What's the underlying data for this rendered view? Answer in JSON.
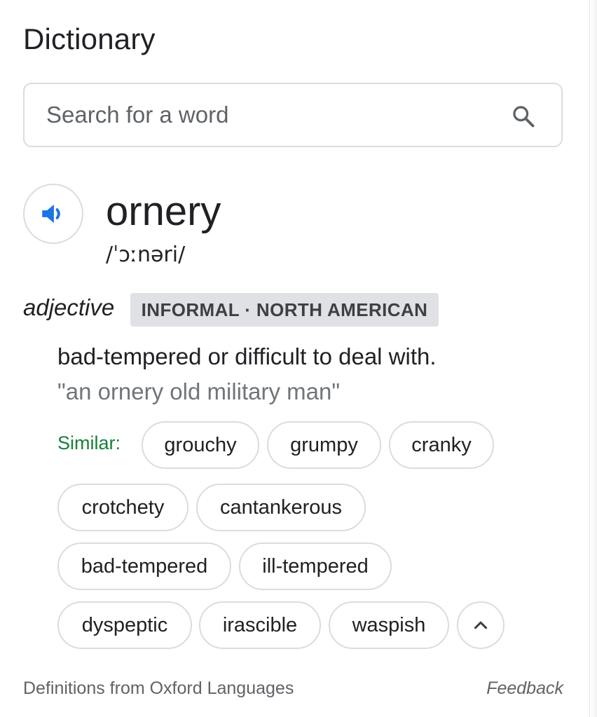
{
  "header": {
    "title": "Dictionary"
  },
  "search": {
    "placeholder": "Search for a word",
    "value": "",
    "icon": "search-icon"
  },
  "entry": {
    "audio_icon": "speaker-icon",
    "word": "ornery",
    "phonetic": "/ˈɔːnəri/",
    "part_of_speech": "adjective",
    "label": "INFORMAL · NORTH AMERICAN",
    "definition": "bad-tempered or difficult to deal with.",
    "example": "\"an ornery old military man\"",
    "similar_label": "Similar:",
    "similar": [
      "grouchy",
      "grumpy",
      "cranky",
      "crotchety",
      "cantankerous",
      "bad-tempered",
      "ill-tempered",
      "dyspeptic",
      "irascible",
      "waspish"
    ],
    "collapse_icon": "chevron-up-icon"
  },
  "footer": {
    "source": "Definitions from Oxford Languages",
    "feedback": "Feedback"
  },
  "colors": {
    "accent_blue": "#1a73e8",
    "similar_green": "#188038",
    "chip_border": "#dadce0",
    "label_bg": "#dfe1e5"
  }
}
